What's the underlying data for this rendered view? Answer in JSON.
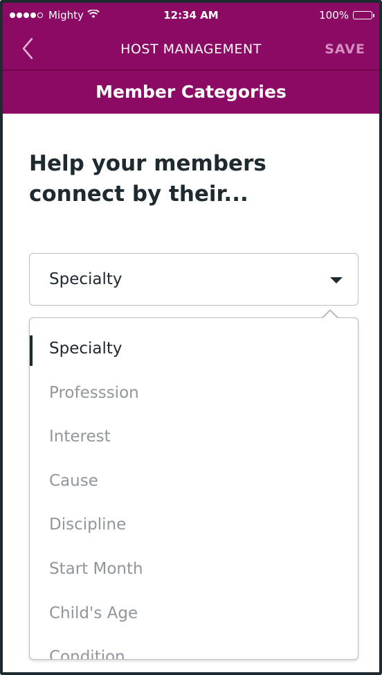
{
  "status_bar": {
    "carrier": "Mighty",
    "time": "12:34 AM",
    "battery": "100%"
  },
  "nav": {
    "title": "HOST MANAGEMENT",
    "save_label": "SAVE"
  },
  "section_title": "Member Categories",
  "heading": "Help your members connect by their...",
  "select": {
    "value": "Specialty"
  },
  "dropdown": {
    "options": [
      {
        "label": "Specialty"
      },
      {
        "label": "Professsion"
      },
      {
        "label": "Interest"
      },
      {
        "label": "Cause"
      },
      {
        "label": "Discipline"
      },
      {
        "label": "Start Month"
      },
      {
        "label": "Child's Age"
      },
      {
        "label": "Condition"
      }
    ]
  },
  "colors": {
    "brand": "#8a0a64",
    "text_dark": "#1f2a30",
    "text_muted": "#8f969c",
    "save_disabled": "#d58fbf"
  }
}
